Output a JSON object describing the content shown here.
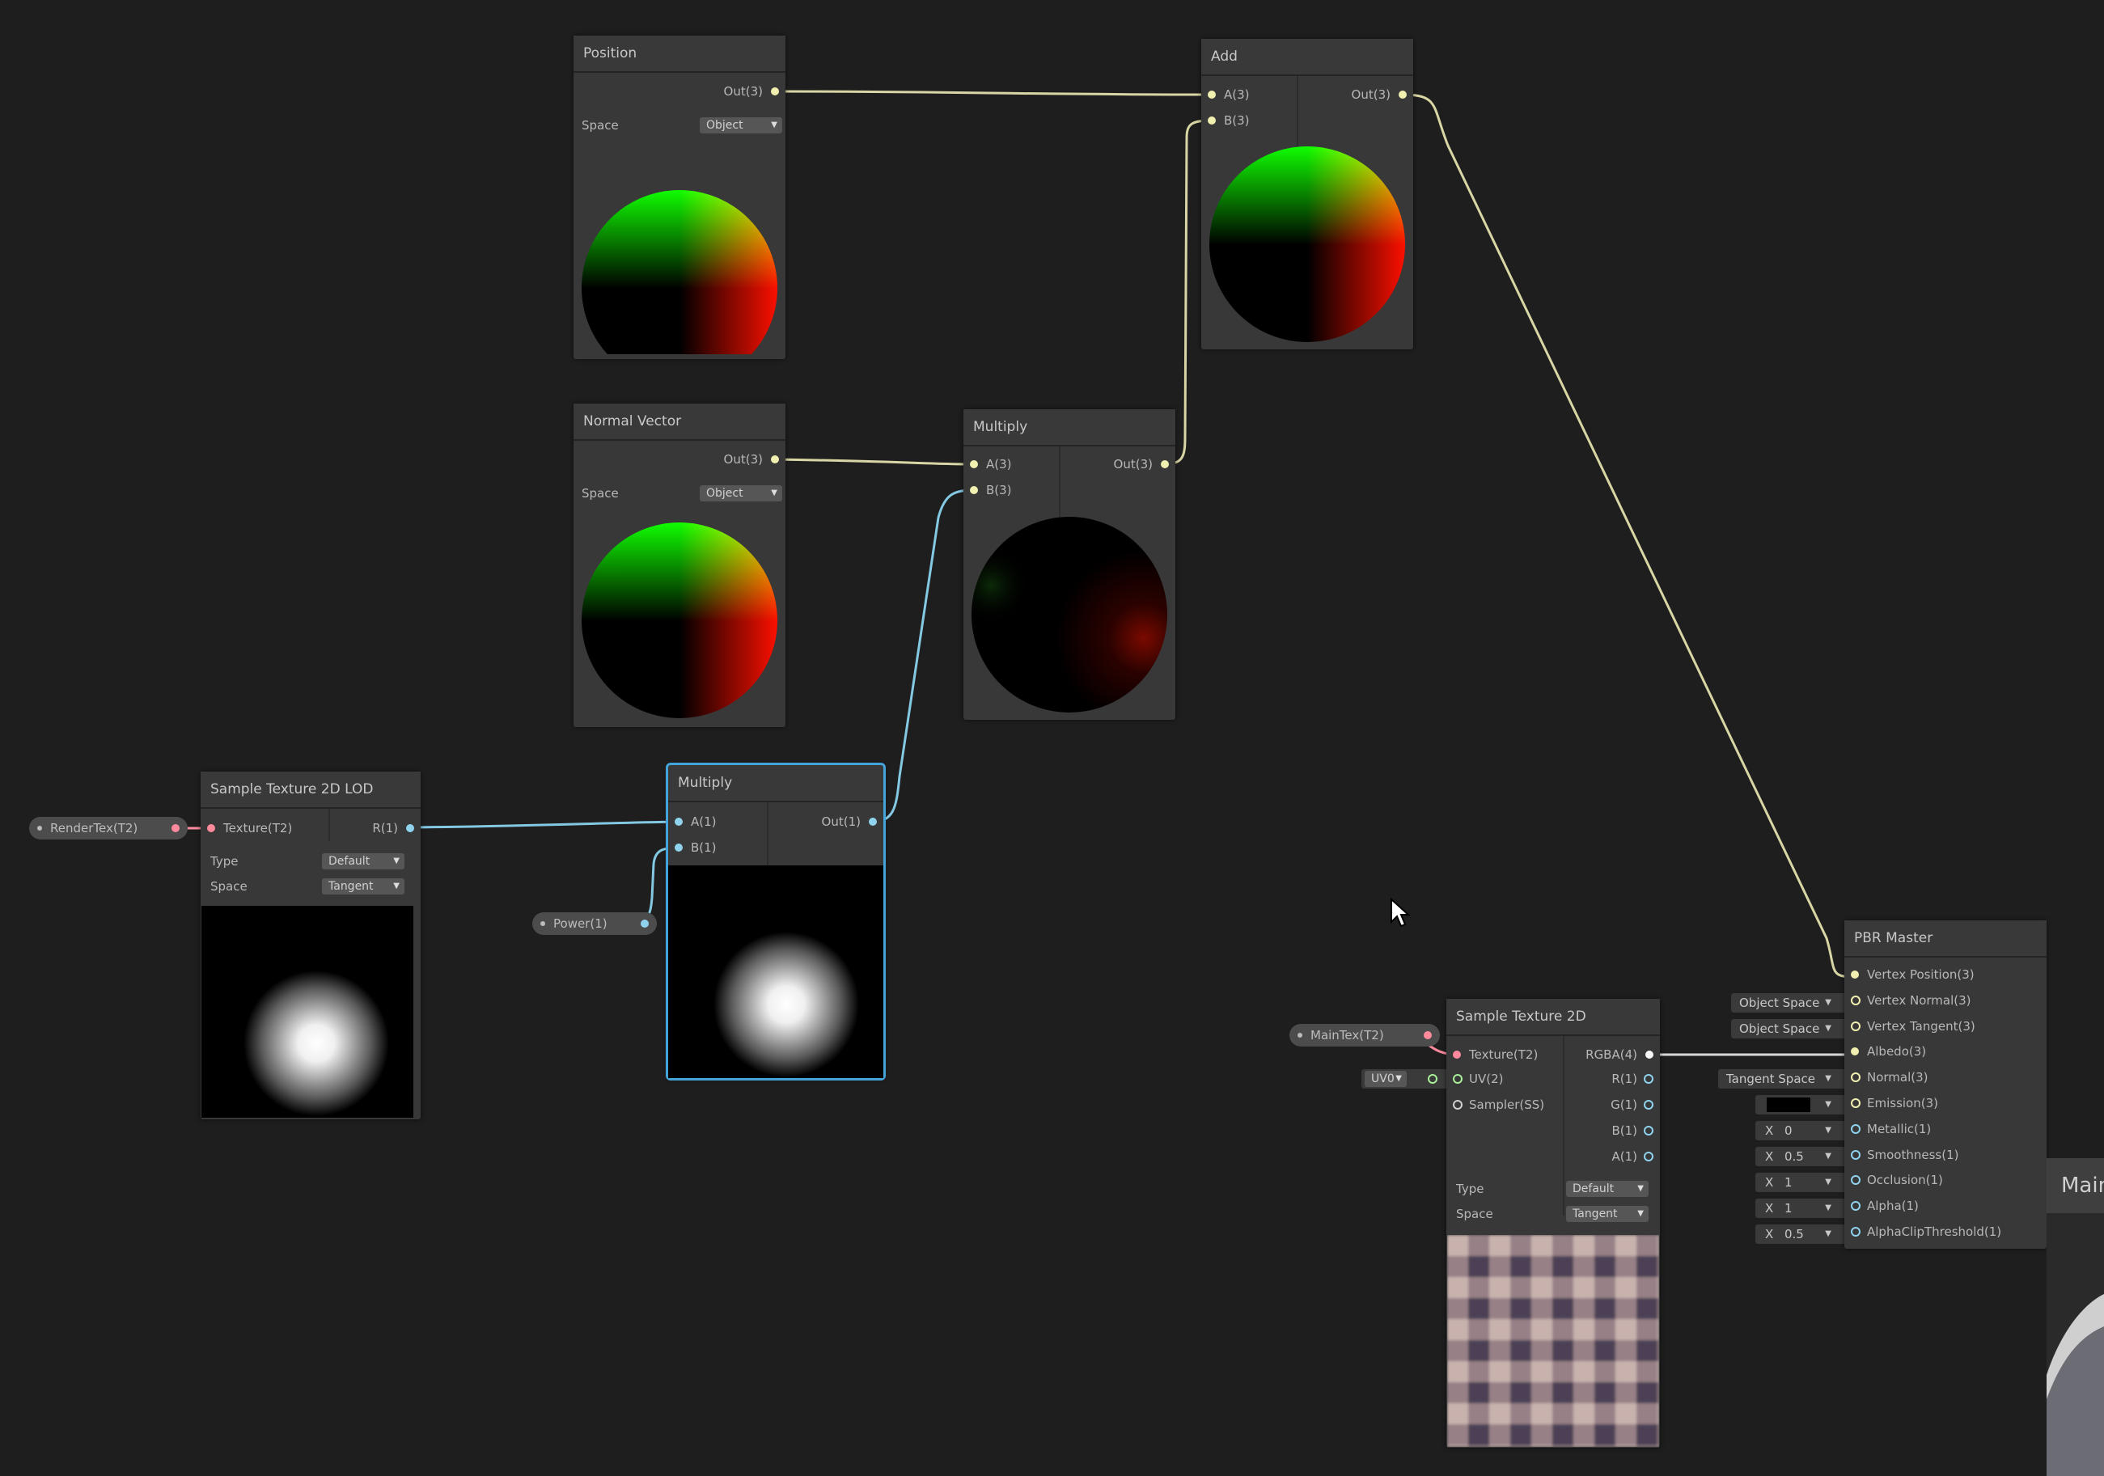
{
  "nodes": {
    "position": {
      "title": "Position",
      "out": "Out(3)",
      "space_label": "Space",
      "space_value": "Object"
    },
    "normal_vector": {
      "title": "Normal Vector",
      "out": "Out(3)",
      "space_label": "Space",
      "space_value": "Object"
    },
    "add": {
      "title": "Add",
      "in_a": "A(3)",
      "in_b": "B(3)",
      "out": "Out(3)"
    },
    "multiply_vec": {
      "title": "Multiply",
      "in_a": "A(3)",
      "in_b": "B(3)",
      "out": "Out(3)"
    },
    "multiply_scalar": {
      "title": "Multiply",
      "in_a": "A(1)",
      "in_b": "B(1)",
      "out": "Out(1)"
    },
    "sample_lod": {
      "title": "Sample Texture 2D LOD",
      "in_texture": "Texture(T2)",
      "out_r": "R(1)",
      "type_label": "Type",
      "type_value": "Default",
      "space_label": "Space",
      "space_value": "Tangent"
    },
    "sample_2d": {
      "title": "Sample Texture 2D",
      "in_texture": "Texture(T2)",
      "in_uv": "UV(2)",
      "in_sampler": "Sampler(SS)",
      "out_rgba": "RGBA(4)",
      "out_r": "R(1)",
      "out_g": "G(1)",
      "out_b": "B(1)",
      "out_a": "A(1)",
      "type_label": "Type",
      "type_value": "Default",
      "space_label": "Space",
      "space_value": "Tangent"
    },
    "pbr_master": {
      "title": "PBR Master",
      "inputs": [
        "Vertex Position(3)",
        "Vertex Normal(3)",
        "Vertex Tangent(3)",
        "Albedo(3)",
        "Normal(3)",
        "Emission(3)",
        "Metallic(1)",
        "Smoothness(1)",
        "Occlusion(1)",
        "Alpha(1)",
        "AlphaClipThreshold(1)"
      ]
    }
  },
  "properties": {
    "render_tex": "RenderTex(T2)",
    "power": "Power(1)",
    "main_tex": "MainTex(T2)"
  },
  "inline_inputs": {
    "uv_channel": "UV0",
    "vertex_normal_space": "Object Space",
    "vertex_tangent_space": "Object Space",
    "normal_space": "Tangent Space",
    "axis_label": "X",
    "metallic": "0",
    "smoothness": "0.5",
    "occlusion": "1",
    "alpha": "1",
    "alpha_clip": "0.5"
  },
  "side_panel": {
    "label": "Main"
  },
  "colors": {
    "wire_vector3": "#d8d6a4",
    "wire_vector1": "#84c9e3",
    "wire_texture": "#ff8a9e",
    "selection": "#44a3d8",
    "node_bg": "#383838",
    "canvas_bg": "#1e1e1e"
  }
}
